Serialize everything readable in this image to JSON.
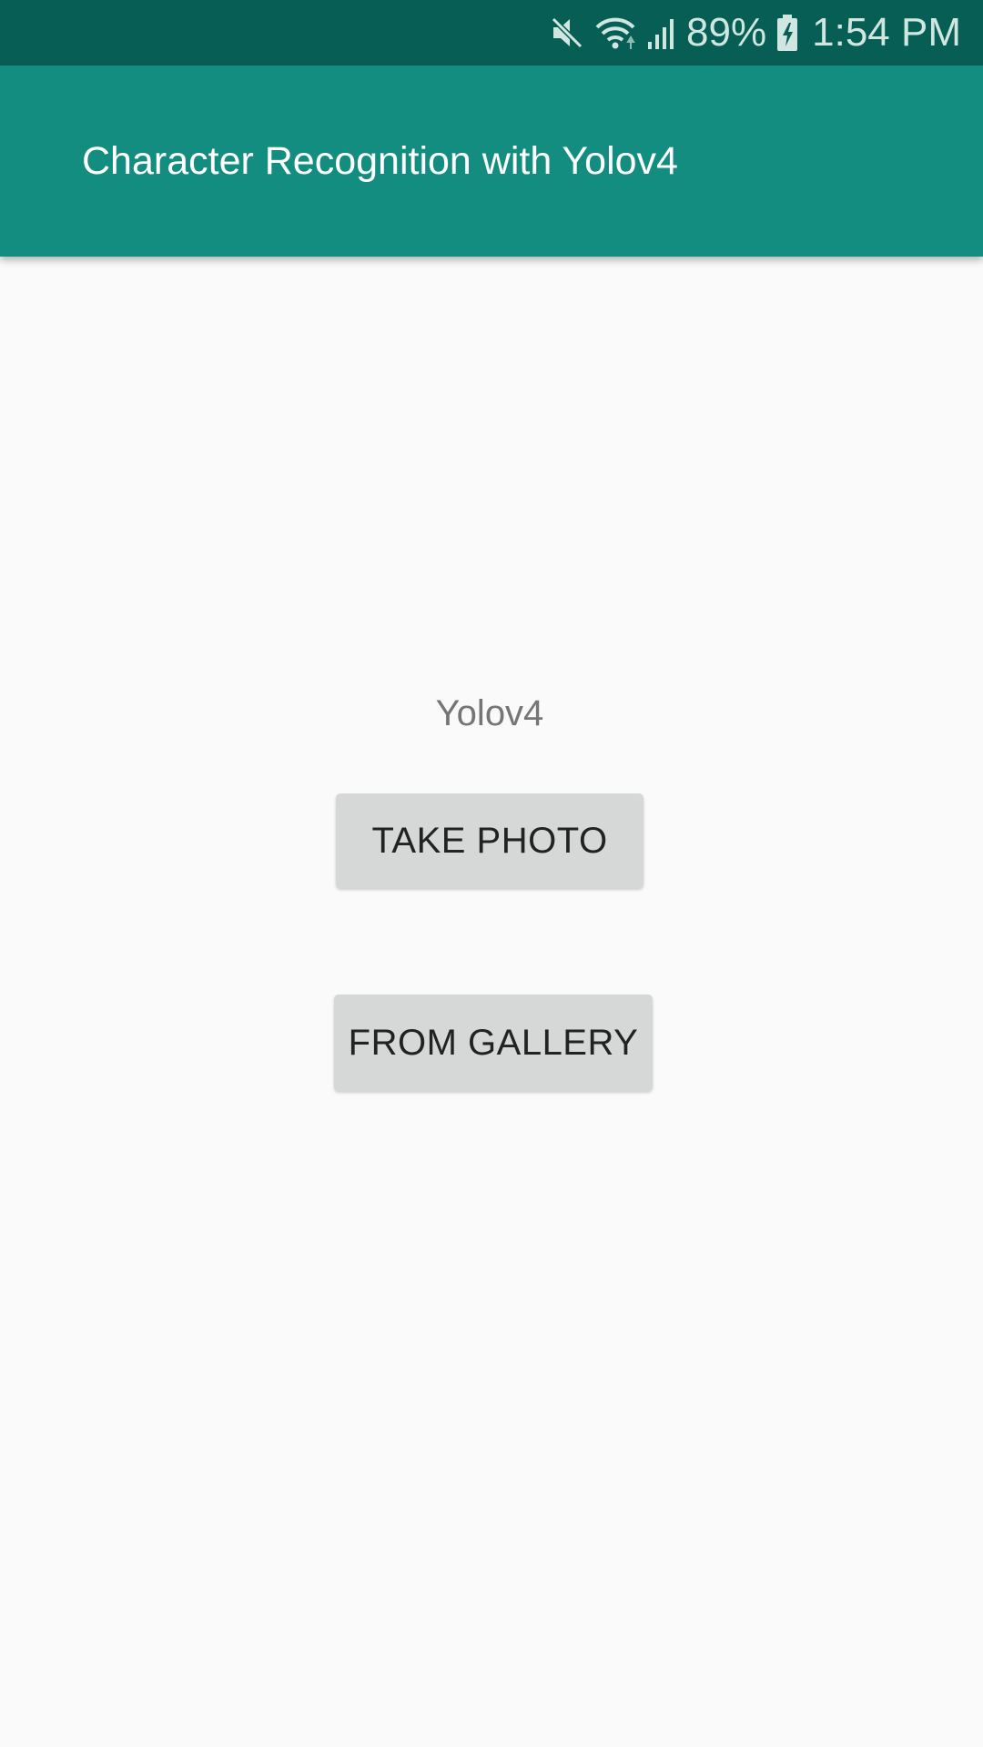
{
  "status_bar": {
    "icons": [
      "mute-icon",
      "wifi-icon",
      "signal-icon",
      "battery-charging-icon"
    ],
    "battery": "89%",
    "time": "1:54 PM"
  },
  "app_bar": {
    "title": "Character Recognition with Yolov4"
  },
  "main": {
    "model_label": "Yolov4",
    "take_photo_label": "TAKE PHOTO",
    "from_gallery_label": "FROM GALLERY"
  },
  "colors": {
    "status_bar": "#075e54",
    "app_bar": "#138d80",
    "background": "#fafafa",
    "button": "#d6d7d7"
  }
}
